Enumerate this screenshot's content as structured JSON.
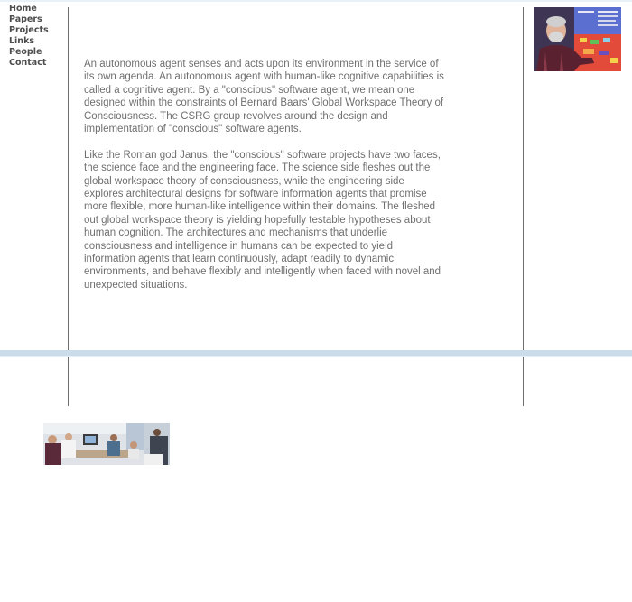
{
  "nav": {
    "items": [
      "Home",
      "Papers",
      "Projects",
      "Links",
      "People",
      "Contact"
    ]
  },
  "main": {
    "paragraphs": [
      "An autonomous agent senses and acts upon its environment in the service of its own agenda. An autonomous agent with human-like cognitive capabilities is called a cognitive agent. By a \"conscious\" software agent, we mean one designed within the constraints of Bernard Baars' Global Workspace Theory of Consciousness. The CSRG group revolves around the design and implementation of \"conscious\" software agents.",
      "Like the Roman god Janus, the \"conscious\" software projects have two faces, the science face and the engineering face. The science side fleshes out the global workspace theory of consciousness, while the engineering side explores architectural designs for software information agents that promise more flexible, more human-like intelligence within their domains. The fleshed out global workspace theory is yielding hopefully testable hypotheses about human cognition. The architectures and mechanisms that underlie consciousness and intelligence in humans can be expected to yield information agents that learn continuously, adapt readily to dynamic environments, and behave flexibly and intelligently when faced with novel and unexpected situations."
    ]
  },
  "colors": {
    "nav_text": "#4d4d4d",
    "body_text": "#6f6f6f",
    "rule": "#6f6f6f",
    "band": "#cadbea"
  }
}
